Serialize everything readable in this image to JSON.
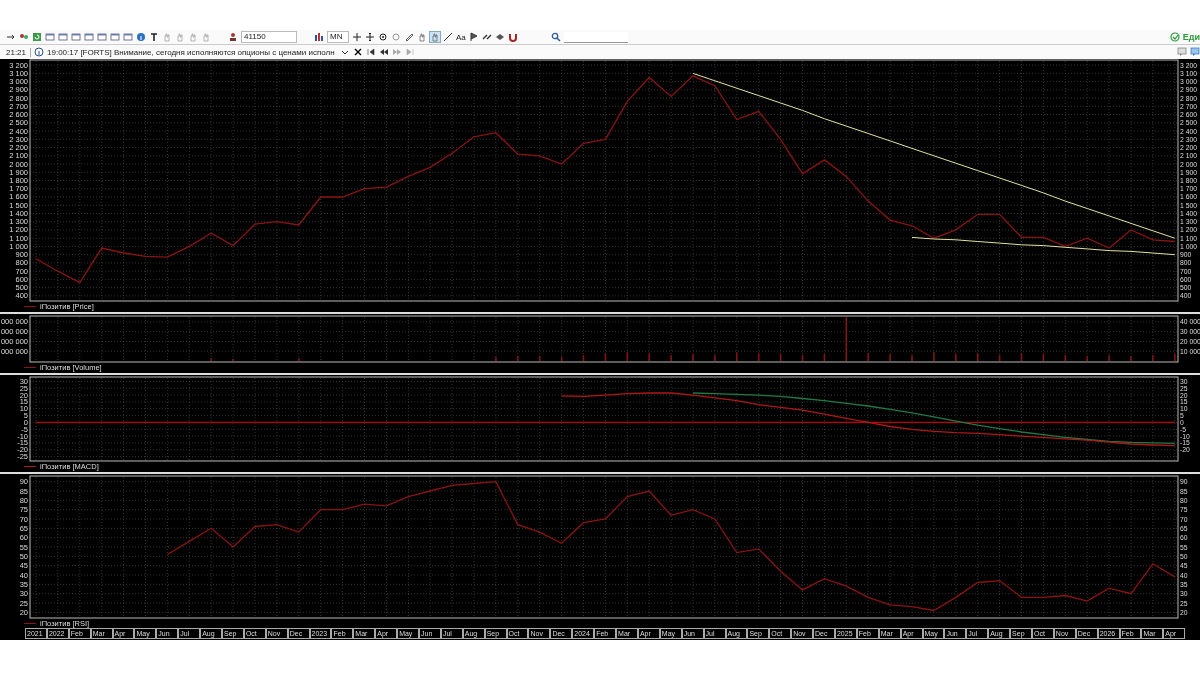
{
  "toolbar": {
    "security_field": "41150",
    "timeframe": "MN",
    "text_tool": "Aa",
    "account_text": "Еди"
  },
  "news_bar": {
    "time": "21:21",
    "message": "19:00:17  [FORTS] Внимание, сегодня исполняются опционы с ценами исполн"
  },
  "panels": [
    {
      "legend": "iПозитив [Price]",
      "right_axis_labels": [
        "3 200",
        "3 100",
        "3 000",
        "2 900",
        "2 800",
        "2 700",
        "2 600",
        "2 500",
        "2 400",
        "2 300",
        "2 200",
        "2 100",
        "2 000",
        "1 900",
        "1 800",
        "1 700",
        "1 600",
        "1 500",
        "1 400",
        "1 300",
        "1 200",
        "1 100",
        "1 000",
        "900",
        "800",
        "700",
        "600",
        "500",
        "400"
      ],
      "chart_data": {
        "type": "line",
        "grid": true,
        "ylim": [
          350,
          3250
        ],
        "yticks": [
          {
            "value": 3200,
            "label": "3 200"
          },
          {
            "value": 3100,
            "label": "3 100"
          },
          {
            "value": 3000,
            "label": "3 000"
          },
          {
            "value": 2900,
            "label": "2 900"
          },
          {
            "value": 2800,
            "label": "2 800"
          },
          {
            "value": 2700,
            "label": "2 700"
          },
          {
            "value": 2600,
            "label": "2 600"
          },
          {
            "value": 2500,
            "label": "2 500"
          },
          {
            "value": 2400,
            "label": "2 400"
          },
          {
            "value": 2300,
            "label": "2 300"
          },
          {
            "value": 2200,
            "label": "2 200"
          },
          {
            "value": 2100,
            "label": "2 100"
          },
          {
            "value": 2000,
            "label": "2 000"
          },
          {
            "value": 1900,
            "label": "1 900"
          },
          {
            "value": 1800,
            "label": "1 800"
          },
          {
            "value": 1700,
            "label": "1 700"
          },
          {
            "value": 1600,
            "label": "1 600"
          },
          {
            "value": 1500,
            "label": "1 500"
          },
          {
            "value": 1400,
            "label": "1 400"
          },
          {
            "value": 1300,
            "label": "1 300"
          },
          {
            "value": 1200,
            "label": "1 200"
          },
          {
            "value": 1100,
            "label": "1 100"
          },
          {
            "value": 1000,
            "label": "1 000"
          },
          {
            "value": 900,
            "label": "900"
          },
          {
            "value": 800,
            "label": "800"
          },
          {
            "value": 700,
            "label": "700"
          },
          {
            "value": 600,
            "label": "600"
          },
          {
            "value": 500,
            "label": "500"
          },
          {
            "value": 400,
            "label": "400"
          }
        ],
        "series": [
          {
            "color": "#8a1414",
            "values": [
              850,
              700,
              560,
              980,
              920,
              880,
              870,
              1000,
              1160,
              1010,
              1270,
              1300,
              1260,
              1600,
              1600,
              1700,
              1720,
              1850,
              1960,
              2130,
              2330,
              2380,
              2120,
              2100,
              2000,
              2250,
              2300,
              2760,
              3050,
              2820,
              3070,
              2950,
              2540,
              2640,
              2300,
              1880,
              2050,
              1850,
              1550,
              1320,
              1250,
              1100,
              1200,
              1390,
              1390,
              1110,
              1110,
              1000,
              1100,
              980,
              1200,
              1080,
              1060
            ]
          },
          {
            "color": "#e6e2a0",
            "values": [
              null,
              null,
              null,
              null,
              null,
              null,
              null,
              null,
              null,
              null,
              null,
              null,
              null,
              null,
              null,
              null,
              null,
              null,
              null,
              null,
              null,
              null,
              null,
              null,
              null,
              null,
              null,
              null,
              null,
              null,
              3100,
              3010,
              2920,
              2830,
              2740,
              2650,
              2550,
              2460,
              2370,
              2280,
              2190,
              2100,
              2010,
              1920,
              1830,
              1740,
              1650,
              1550,
              1460,
              1370,
              1280,
              1190,
              1100
            ]
          },
          {
            "color": "#e6e2a0",
            "values": [
              null,
              null,
              null,
              null,
              null,
              null,
              null,
              null,
              null,
              null,
              null,
              null,
              null,
              null,
              null,
              null,
              null,
              null,
              null,
              null,
              null,
              null,
              null,
              null,
              null,
              null,
              null,
              null,
              null,
              null,
              null,
              null,
              null,
              null,
              null,
              null,
              null,
              null,
              null,
              null,
              1110,
              1090,
              1080,
              1060,
              1040,
              1020,
              1010,
              990,
              970,
              950,
              940,
              920,
              900
            ]
          }
        ]
      }
    },
    {
      "legend": "iПозитив [Volume]",
      "left_axis_labels": [
        "000 000",
        "000 000",
        "000 000",
        "000 000"
      ],
      "chart_data": {
        "type": "bar",
        "grid": true,
        "ylim": [
          0,
          45000
        ],
        "yticks": [
          {
            "value": 40000,
            "label": "40 000"
          },
          {
            "value": 30000,
            "label": "30 000"
          },
          {
            "value": 20000,
            "label": "20 000"
          },
          {
            "value": 10000,
            "label": "10 000"
          }
        ],
        "series": [
          {
            "color": "#8a1414",
            "values": [
              null,
              null,
              null,
              null,
              null,
              null,
              null,
              null,
              3000,
              2000,
              null,
              null,
              3000,
              null,
              null,
              null,
              null,
              null,
              null,
              null,
              null,
              4000,
              5000,
              5000,
              4000,
              6000,
              8000,
              9000,
              8000,
              6000,
              7000,
              6000,
              9000,
              8000,
              7000,
              6000,
              7000,
              45000,
              8000,
              7000,
              6000,
              9000,
              7000,
              8000,
              6000,
              8000,
              7000,
              6000,
              5000,
              6000,
              5000,
              6000,
              7000
            ]
          }
        ]
      }
    },
    {
      "legend": "iПозитив [MACD]",
      "right_axis_labels": [
        "30",
        "25",
        "20",
        "15",
        "10",
        "5",
        "0",
        "-5",
        "-10",
        "-15",
        "-20"
      ],
      "chart_data": {
        "type": "line",
        "grid": true,
        "ylim": [
          -27.5,
          32.5
        ],
        "yticks": [
          30,
          25,
          20,
          15,
          10,
          5,
          0,
          -5,
          -10,
          -15,
          -20,
          -25
        ],
        "series": [
          {
            "color": "#c00000",
            "values": [
              0,
              0,
              0,
              0,
              0,
              0,
              0,
              0,
              0,
              0,
              0,
              0,
              0,
              0,
              0,
              0,
              0,
              0,
              0,
              0,
              0,
              0,
              0,
              0,
              0,
              0,
              0,
              0,
              0,
              0,
              0,
              0,
              0,
              0,
              0,
              0,
              0,
              0,
              0,
              0,
              0,
              0,
              0,
              0,
              0,
              0,
              0,
              0,
              0,
              0,
              0,
              0,
              0
            ]
          },
          {
            "color": "#1f7a45",
            "values": [
              null,
              null,
              null,
              null,
              null,
              null,
              null,
              null,
              null,
              null,
              null,
              null,
              null,
              null,
              null,
              null,
              null,
              null,
              null,
              null,
              null,
              null,
              null,
              null,
              null,
              null,
              null,
              null,
              null,
              null,
              21.5,
              21,
              20.5,
              20,
              19,
              17.5,
              16,
              14,
              12,
              9.5,
              7,
              4,
              1,
              -2,
              -4.5,
              -7,
              -9,
              -11,
              -12.5,
              -13.8,
              -14.6,
              -15,
              -15.3
            ]
          },
          {
            "color": "#b01818",
            "values": [
              null,
              null,
              null,
              null,
              null,
              null,
              null,
              null,
              null,
              null,
              null,
              null,
              null,
              null,
              null,
              null,
              null,
              null,
              null,
              null,
              null,
              null,
              null,
              null,
              19.5,
              19,
              20,
              21,
              21.5,
              21.5,
              20,
              18,
              16,
              13,
              11,
              9,
              6,
              3,
              0,
              -3,
              -5,
              -6.5,
              -7.5,
              -8,
              -9,
              -10,
              -11,
              -12,
              -13,
              -14.5,
              -15.8,
              -16.5,
              -17
            ]
          }
        ]
      }
    },
    {
      "legend": "iПозитив [RSI]",
      "right_axis_labels": [
        "90",
        "85",
        "80",
        "75",
        "70",
        "65",
        "60",
        "55",
        "50",
        "45",
        "40",
        "35",
        "30",
        "25",
        "20"
      ],
      "chart_data": {
        "type": "line",
        "grid": true,
        "ylim": [
          17.5,
          92.5
        ],
        "categories": [
          "2021",
          "2022",
          "Feb",
          "Mar",
          "Apr",
          "May",
          "Jun",
          "Jul",
          "Aug",
          "Sep",
          "Oct",
          "Nov",
          "Dec",
          "2023",
          "Feb",
          "Mar",
          "Apr",
          "May",
          "Jun",
          "Jul",
          "Aug",
          "Sep",
          "Oct",
          "Nov",
          "Dec",
          "2024",
          "Feb",
          "Mar",
          "Apr",
          "May",
          "Jun",
          "Jul",
          "Aug",
          "Sep",
          "Oct",
          "Nov",
          "Dec",
          "2025",
          "Feb",
          "Mar",
          "Apr",
          "May",
          "Jun",
          "Jul",
          "Aug",
          "Sep",
          "Oct",
          "Nov",
          "Dec",
          "2026",
          "Feb",
          "Mar",
          "Apr"
        ],
        "yticks": [
          90,
          85,
          80,
          75,
          70,
          65,
          60,
          55,
          50,
          45,
          40,
          35,
          30,
          25,
          20
        ],
        "series": [
          {
            "color": "#8a1414",
            "values": [
              null,
              null,
              null,
              null,
              null,
              null,
              51,
              58,
              65,
              55,
              66,
              67,
              63,
              75,
              75,
              78,
              77,
              82,
              85,
              88,
              89,
              90,
              67,
              63,
              57,
              68,
              70,
              82,
              85,
              72,
              75,
              70,
              52,
              54,
              42,
              32,
              38,
              34,
              28,
              24,
              23,
              21,
              28,
              36,
              37,
              28,
              28,
              29,
              26,
              33,
              30,
              46,
              39
            ]
          }
        ]
      }
    }
  ]
}
